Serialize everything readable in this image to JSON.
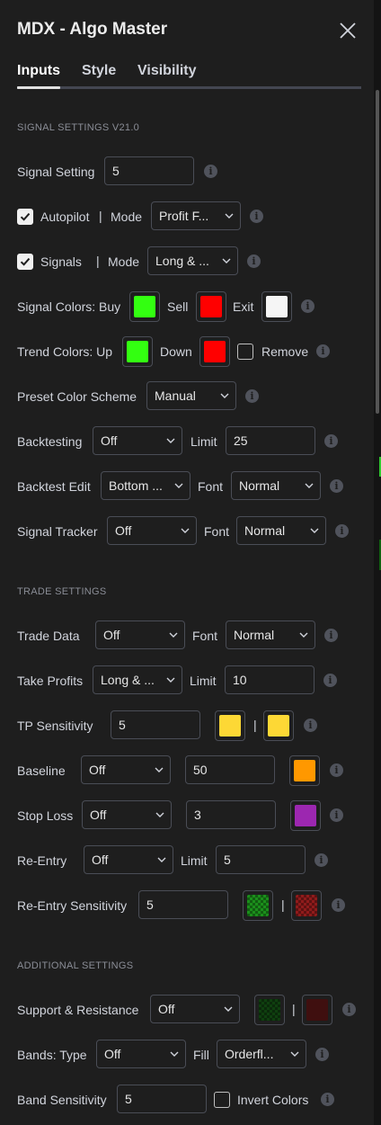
{
  "window": {
    "title": "MDX - Algo Master"
  },
  "tabs": [
    {
      "label": "Inputs",
      "active": true
    },
    {
      "label": "Style",
      "active": false
    },
    {
      "label": "Visibility",
      "active": false
    }
  ],
  "sections": {
    "signal": "SIGNAL SETTINGS V21.0",
    "trade": "TRADE SETTINGS",
    "additional": "ADDITIONAL SETTINGS"
  },
  "rows": {
    "signal_setting": {
      "label": "Signal Setting",
      "value": "5"
    },
    "autopilot": {
      "label": "Autopilot",
      "checked": true,
      "pipe": "|",
      "mode_label": "Mode",
      "mode_value": "Profit F..."
    },
    "signals": {
      "label": "Signals",
      "checked": true,
      "pipe": "|",
      "mode_label": "Mode",
      "mode_value": "Long & ..."
    },
    "signal_colors": {
      "label": "Signal Colors: Buy",
      "sell_label": "Sell",
      "exit_label": "Exit",
      "buy_color": "#33ff11",
      "sell_color": "#ff0000",
      "exit_color": "#f5f5f5"
    },
    "trend_colors": {
      "label": "Trend Colors: Up",
      "down_label": "Down",
      "remove_label": "Remove",
      "up_color": "#33ff11",
      "down_color": "#ff0000",
      "remove_checked": false
    },
    "preset_color": {
      "label": "Preset Color Scheme",
      "value": "Manual"
    },
    "backtesting": {
      "label": "Backtesting",
      "value": "Off",
      "limit_label": "Limit",
      "limit_value": "25"
    },
    "backtest_edit": {
      "label": "Backtest Edit",
      "value": "Bottom ...",
      "font_label": "Font",
      "font_value": "Normal"
    },
    "signal_tracker": {
      "label": "Signal Tracker",
      "value": "Off",
      "font_label": "Font",
      "font_value": "Normal"
    },
    "trade_data": {
      "label": "Trade Data",
      "value": "Off",
      "font_label": "Font",
      "font_value": "Normal"
    },
    "take_profits": {
      "label": "Take Profits",
      "value": "Long & ...",
      "limit_label": "Limit",
      "limit_value": "10"
    },
    "tp_sensitivity": {
      "label": "TP Sensitivity",
      "value": "5",
      "pipe": "|",
      "color1": "#fdd835",
      "color2": "#fdd835"
    },
    "baseline": {
      "label": "Baseline",
      "value": "Off",
      "num_value": "50",
      "color": "#ff9800"
    },
    "stop_loss": {
      "label": "Stop Loss",
      "value": "Off",
      "num_value": "3",
      "color": "#9c27b0"
    },
    "re_entry": {
      "label": "Re-Entry",
      "value": "Off",
      "limit_label": "Limit",
      "limit_value": "5"
    },
    "re_entry_sensitivity": {
      "label": "Re-Entry Sensitivity",
      "value": "5",
      "pipe": "|",
      "color1": "#1b8f1b",
      "color2": "#8f1b1b"
    },
    "support_resistance": {
      "label": "Support & Resistance",
      "value": "Off",
      "pipe": "|",
      "color1": "#0f3f0f",
      "color2": "#3f0f0f"
    },
    "bands_type": {
      "label": "Bands: Type",
      "value": "Off",
      "fill_label": "Fill",
      "fill_value": "Orderfl..."
    },
    "band_sensitivity": {
      "label": "Band Sensitivity",
      "value": "5",
      "invert_label": "Invert Colors",
      "invert_checked": false
    }
  },
  "icons": {
    "close": "close-icon",
    "info": "info-icon",
    "chevron": "chevron-down-icon",
    "check": "check-icon"
  },
  "colors": {
    "background": "#1e1e1e",
    "border": "#4a4d56",
    "text": "#d1d4dc",
    "accent": "#e0e0e0"
  }
}
